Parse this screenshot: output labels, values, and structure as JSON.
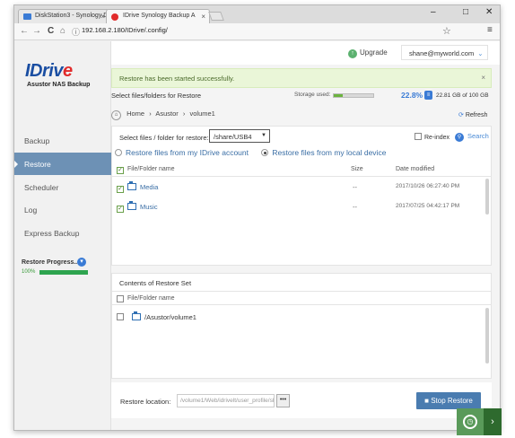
{
  "browser": {
    "tabs": [
      {
        "label": "DiskStation3 - Synology D",
        "favicon_color": "#3a7bd5"
      },
      {
        "label": "IDrive Synology Backup A",
        "favicon_color": "#e12b2b"
      }
    ],
    "url": "192.168.2.180/IDrive/.config/",
    "controls": {
      "minimize": "–",
      "maximize": "□",
      "close": "✕"
    },
    "icons": {
      "back": "←",
      "forward": "→",
      "reload": "C",
      "home": "⌂",
      "info": "ⓘ",
      "star": "☆",
      "menu": "≡"
    }
  },
  "brand": {
    "logo_main": "IDriv",
    "logo_e": "e",
    "subtitle": "Asustor NAS Backup"
  },
  "sidebar": {
    "items": [
      {
        "label": "Backup",
        "active": false
      },
      {
        "label": "Restore",
        "active": true
      },
      {
        "label": "Scheduler",
        "active": false
      },
      {
        "label": "Log",
        "active": false
      },
      {
        "label": "Express Backup",
        "active": false
      }
    ],
    "progress": {
      "label": "Restore Progress...",
      "percent_text": "100%",
      "percent": 100
    }
  },
  "header": {
    "upgrade_label": "Upgrade",
    "account": "shane@myworld.com"
  },
  "banner": {
    "message": "Restore has been started successfully.",
    "close": "×"
  },
  "restore": {
    "section_title": "Select files/folders for Restore",
    "storage": {
      "label": "Storage used:",
      "percent_text": "22.8%",
      "percent": 22.8,
      "detail": "22.81 GB of 100 GB"
    },
    "breadcrumb": {
      "home": "Home",
      "path": [
        "Asustor",
        "volume1"
      ],
      "sep": "›"
    },
    "refresh_label": "Refresh",
    "folder_select_label": "Select files / folder for restore:",
    "folder_select_value": "/share/USB4",
    "reindex_label": "Re-index",
    "search_label": "Search",
    "options": [
      {
        "label": "Restore files from my IDrive account",
        "selected": false
      },
      {
        "label": "Restore files from my local device",
        "selected": true
      }
    ],
    "columns": {
      "name": "File/Folder name",
      "size": "Size",
      "modified": "Date modified"
    },
    "rows": [
      {
        "name": "Media",
        "size": "--",
        "modified": "2017/10/26 06:27:40 PM",
        "checked": true
      },
      {
        "name": "Music",
        "size": "--",
        "modified": "2017/07/25 04:42:17 PM",
        "checked": true
      }
    ]
  },
  "restore_set": {
    "title": "Contents of Restore Set",
    "column": "File/Folder name",
    "items": [
      {
        "name": "/Asustor/volume1"
      }
    ]
  },
  "footer": {
    "location_label": "Restore location:",
    "location_value": "/volume1/Web/idrivelt/user_profile/sha",
    "browse_label": "•••",
    "stop_label": "Stop Restore"
  },
  "colors": {
    "accent": "#3a7bd5",
    "sidebar_active": "#6d91b5",
    "success_bg": "#eaf6d8",
    "stop_button": "#4a7cb0"
  }
}
